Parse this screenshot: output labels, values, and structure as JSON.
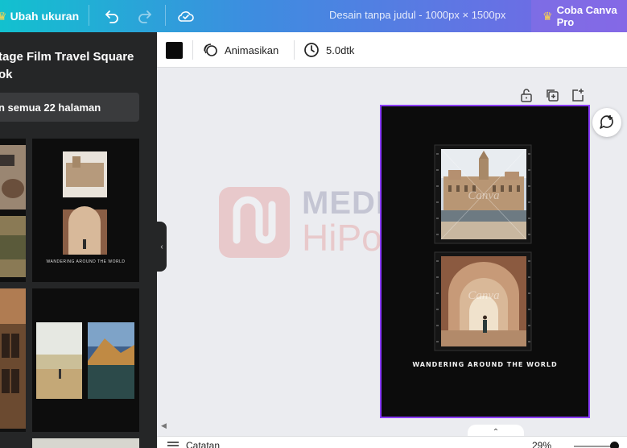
{
  "topbar": {
    "resize_label": "Ubah ukuran",
    "title": "Desain tanpa judul - 1000px × 1500px",
    "pro_label": "Coba Canva Pro",
    "colors": {
      "accent_yellow": "#ffd54a"
    }
  },
  "sidepanel": {
    "template_title": "tage Film Travel Square ok",
    "apply_all_label": "n semua 22 halaman"
  },
  "toolbar": {
    "animate_label": "Animasikan",
    "duration_label": "5.0dtk"
  },
  "design": {
    "caption": "WANDERING AROUND THE WORLD",
    "photo_watermark": "Canva",
    "thumb_caption": "WANDERING AROUND THE WORLD"
  },
  "watermark": {
    "line1": "MEDIA",
    "line2": "HiPoin"
  },
  "bottombar": {
    "notes_label": "Catatan",
    "zoom_label": "29%",
    "zoom_level": 0.29
  }
}
